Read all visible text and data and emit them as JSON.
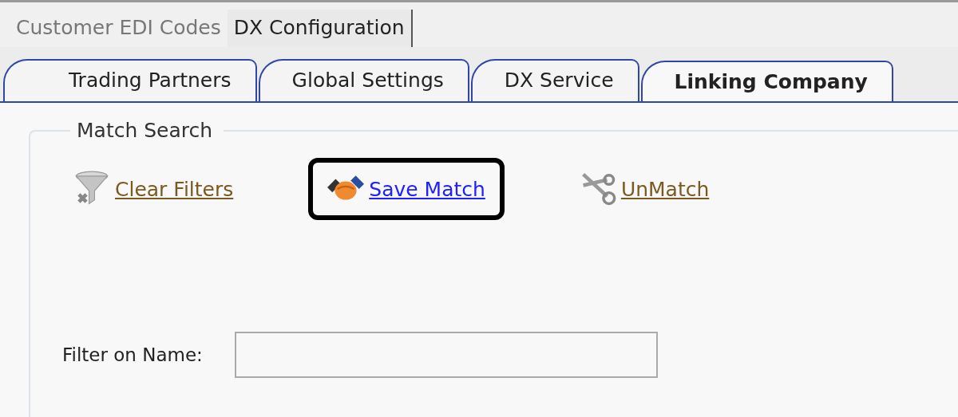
{
  "top_tabs": [
    {
      "label": "Customer EDI Codes",
      "selected": false
    },
    {
      "label": "DX Configuration",
      "selected": true
    }
  ],
  "tabs": [
    {
      "label": "Trading Partners",
      "selected": false
    },
    {
      "label": "Global Settings",
      "selected": false
    },
    {
      "label": "DX Service",
      "selected": false
    },
    {
      "label": "Linking Company",
      "selected": true
    }
  ],
  "group": {
    "title": "Match Search",
    "actions": [
      {
        "kind": "funnel",
        "label": "Clear Filters",
        "disabled": true,
        "highlighted": false
      },
      {
        "kind": "handshake",
        "label": "Save Match",
        "disabled": false,
        "highlighted": true
      },
      {
        "kind": "scissors",
        "label": "UnMatch",
        "disabled": true,
        "highlighted": false
      }
    ],
    "filter": {
      "label": "Filter on Name:"
    }
  }
}
